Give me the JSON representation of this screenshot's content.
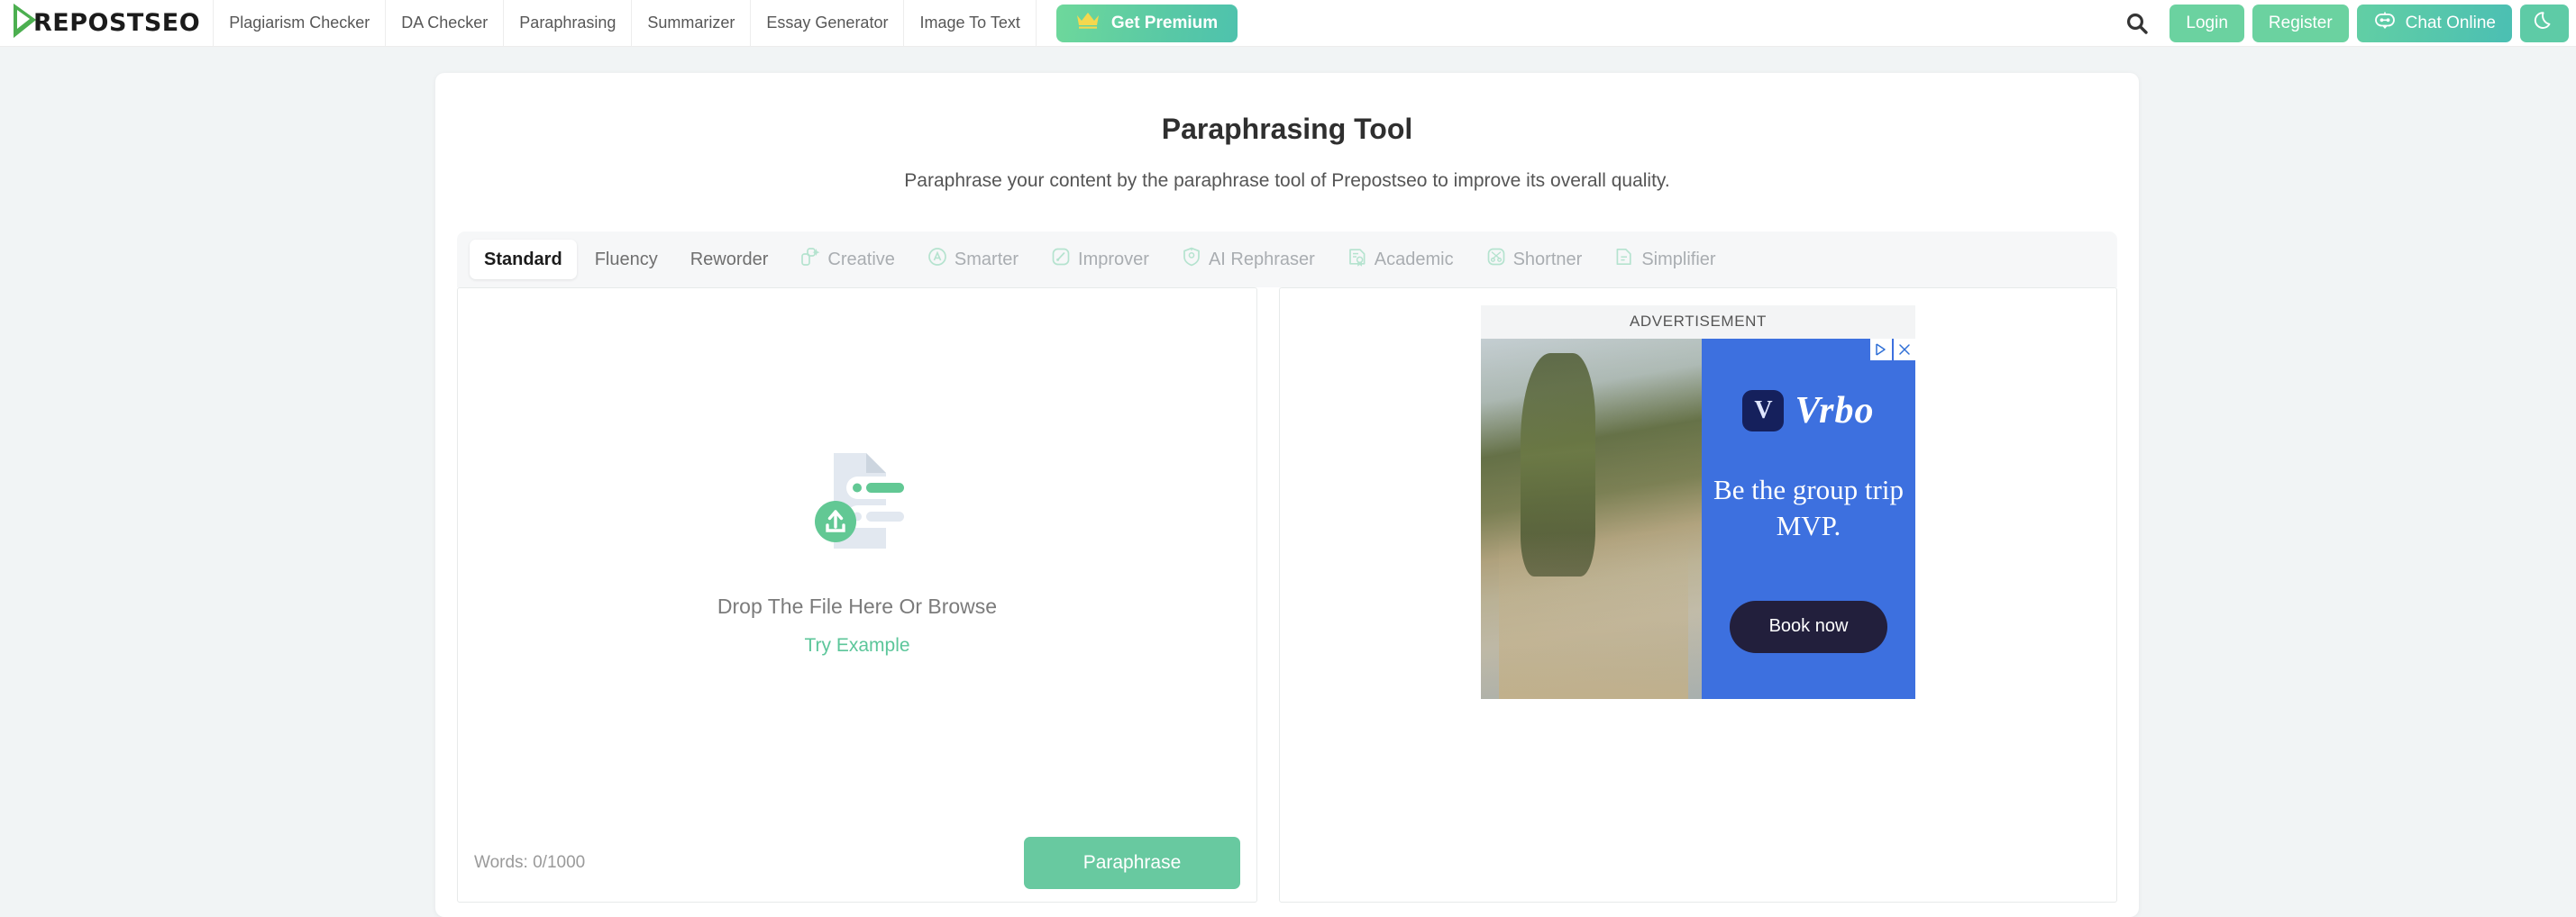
{
  "header": {
    "logo_text": "REPOSTSEO",
    "logo_icon": "play-triangle-logo-icon",
    "nav_items": [
      {
        "label": "Plagiarism Checker"
      },
      {
        "label": "DA Checker"
      },
      {
        "label": "Paraphrasing"
      },
      {
        "label": "Summarizer"
      },
      {
        "label": "Essay Generator"
      },
      {
        "label": "Image To Text"
      }
    ],
    "premium_button": {
      "label": "Get Premium",
      "icon": "crown-icon"
    },
    "search_icon": "search-icon",
    "login_label": "Login",
    "register_label": "Register",
    "chat_label": "Chat Online",
    "chat_icon": "chat-bot-icon",
    "dark_mode_icon": "moon-icon"
  },
  "main": {
    "title": "Paraphrasing Tool",
    "subtitle": "Paraphrase your content by the paraphrase tool of Prepostseo to improve its overall quality.",
    "tabs": [
      {
        "label": "Standard",
        "icon": null,
        "active": true,
        "muted": false
      },
      {
        "label": "Fluency",
        "icon": null,
        "active": false,
        "muted": false
      },
      {
        "label": "Reworder",
        "icon": null,
        "active": false,
        "muted": false
      },
      {
        "label": "Creative",
        "icon": "sparkle-layers-icon",
        "active": false,
        "muted": true
      },
      {
        "label": "Smarter",
        "icon": "circle-a-icon",
        "active": false,
        "muted": true
      },
      {
        "label": "Improver",
        "icon": "rounded-square-pen-icon",
        "active": false,
        "muted": true
      },
      {
        "label": "AI Rephraser",
        "icon": "shield-gear-icon",
        "active": false,
        "muted": true
      },
      {
        "label": "Academic",
        "icon": "document-award-icon",
        "active": false,
        "muted": true
      },
      {
        "label": "Shortner",
        "icon": "scissors-icon",
        "active": false,
        "muted": true
      },
      {
        "label": "Simplifier",
        "icon": "document-lines-icon",
        "active": false,
        "muted": true
      }
    ],
    "editor": {
      "dropzone_icon": "file-upload-icon",
      "drop_text": "Drop The File Here Or Browse",
      "try_example_label": "Try Example",
      "word_count": "Words: 0/1000",
      "paraphrase_label": "Paraphrase"
    },
    "ad": {
      "label": "ADVERTISEMENT",
      "brand_mark": "V",
      "brand_name": "Vrbo",
      "headline": "Be the group trip MVP.",
      "cta_label": "Book now",
      "info_icon": "ad-choices-icon",
      "close_icon": "close-icon",
      "background_color": "#3d70df"
    }
  },
  "colors": {
    "accent_green": "#68c9a0",
    "page_background": "#f1f4f5",
    "ad_blue": "#3d70df",
    "crown_yellow": "#f5d84e"
  }
}
